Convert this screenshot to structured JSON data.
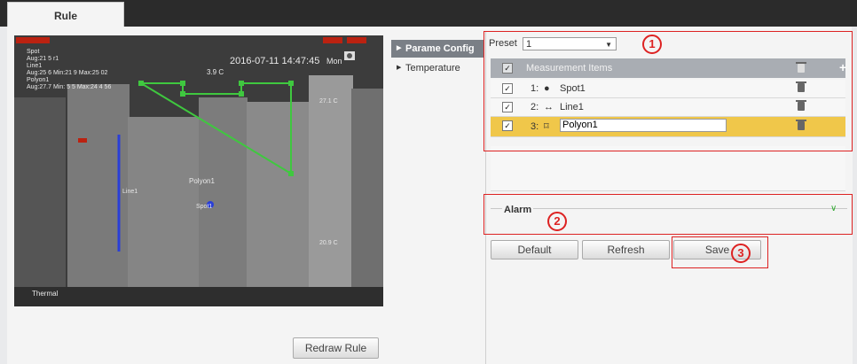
{
  "tabs": {
    "rule": "Rule"
  },
  "video": {
    "osd_left": "Spot\nAug:21 5 r1\nLine1\nAug:25 6 Min:21 9 Max:25 02\nPolyon1\nAug:27.7 Min: 5 5 Max:24 4 56",
    "timestamp": "2016-07-11 14:47:45",
    "ts_suffix": "Mon",
    "value_top": "3.9 C",
    "value_right": "27.1 C",
    "value_right2": "20.9 C",
    "label_spot": "Spot1",
    "label_poly": "Polyon1",
    "label_line": "Line1",
    "watermark": "Thermal"
  },
  "buttons": {
    "redraw": "Redraw Rule",
    "default": "Default",
    "refresh": "Refresh",
    "save": "Save"
  },
  "nav": {
    "parame_config": "Parame Config",
    "temperature": "Temperature"
  },
  "preset": {
    "label": "Preset",
    "value": "1"
  },
  "table": {
    "header": "Measurement Items",
    "rows": [
      {
        "index": "1:",
        "icon": "●",
        "name": "Spot1"
      },
      {
        "index": "2:",
        "icon": "↔",
        "name": "Line1"
      },
      {
        "index": "3:",
        "icon": "⌑",
        "name": "Polyon1"
      }
    ]
  },
  "alarm": {
    "label": "Alarm"
  },
  "callouts": {
    "one": "1",
    "two": "2",
    "three": "3"
  },
  "colors": {
    "accent_red": "#d22222",
    "selected_row": "#f0c74a",
    "roi_green": "#3fc83f",
    "line_blue": "#2a3fd8"
  }
}
